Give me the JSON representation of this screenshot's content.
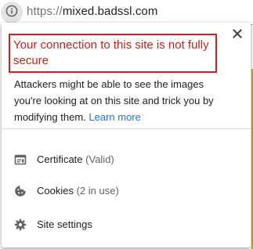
{
  "omnibox": {
    "url_scheme": "https://",
    "url_host": "mixed.badssl.com",
    "info_icon": "info-circle-icon"
  },
  "popup": {
    "headline": "Your connection to this site is not fully secure",
    "description": "Attackers might be able to see the images you're looking at on this site and trick you by modifying them.",
    "learn_more": "Learn more",
    "close_icon": "close-icon",
    "items": [
      {
        "label": "Certificate",
        "status": "(Valid)",
        "icon": "certificate-icon"
      },
      {
        "label": "Cookies",
        "status": "(2 in use)",
        "icon": "cookie-icon"
      },
      {
        "label": "Site settings",
        "status": "",
        "icon": "gear-icon"
      }
    ]
  },
  "colors": {
    "warning_red": "#c5221f",
    "link_blue": "#1a73e8",
    "icon_gray": "#5f6368",
    "site_accent": "#d3a70f"
  }
}
